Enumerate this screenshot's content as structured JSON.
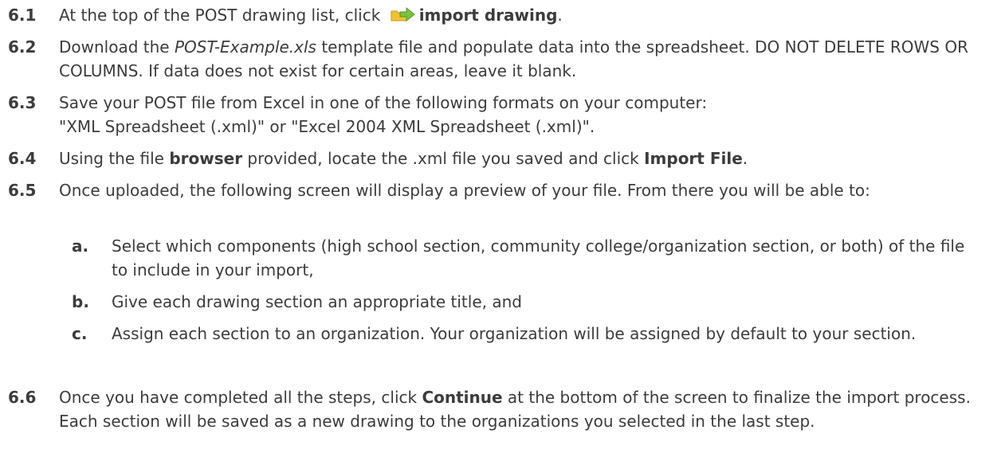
{
  "steps": [
    {
      "num": "6.1",
      "pre": "At the top of the POST drawing list, click",
      "icon": "import-drawing-icon",
      "bold": "import drawing",
      "post": "."
    },
    {
      "num": "6.2",
      "pre": "Download the ",
      "italic": "POST-Example.xls",
      "post": " template file and populate data into the spreadsheet. DO NOT DELETE ROWS OR COLUMNS. If data does not exist for certain areas, leave it blank."
    },
    {
      "num": "6.3",
      "line1": "Save your POST file from Excel in one of the following formats on your computer:",
      "line2": "\"XML Spreadsheet (.xml)\" or \"Excel 2004 XML Spreadsheet (.xml)\"."
    },
    {
      "num": "6.4",
      "pre": "Using the file ",
      "bold1": "browser",
      "mid": " provided, locate the .xml file you saved and click ",
      "bold2": "Import File",
      "post": "."
    },
    {
      "num": "6.5",
      "text": "Once uploaded, the following screen will display a preview of your file. From there you will be able to:",
      "subs": [
        {
          "letter": "a.",
          "text": "Select which components (high school section, community college/organization section, or both) of the file to include in your import,"
        },
        {
          "letter": "b.",
          "text": "Give each drawing section an appropriate title, and"
        },
        {
          "letter": "c.",
          "text": "Assign each section to an organization. Your organization will be assigned by default to your section."
        }
      ]
    },
    {
      "num": "6.6",
      "pre": "Once you have completed all the steps, click ",
      "bold": "Continue",
      "post": " at the bottom of the screen to finalize the import process. Each section will be saved as a new drawing to the organizations you selected in the last step."
    }
  ],
  "colors": {
    "text": "#3c3c3c",
    "icon_arrow": "#7cc242",
    "icon_folder": "#f2c230"
  }
}
